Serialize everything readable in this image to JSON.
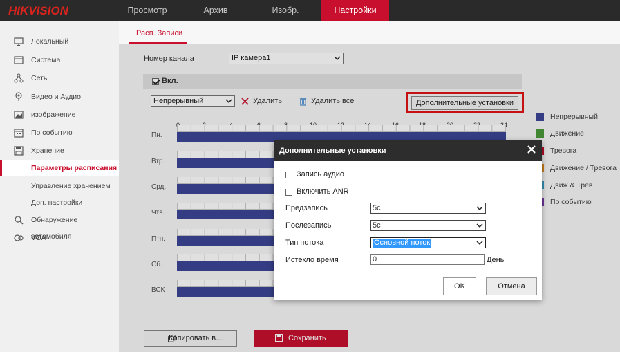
{
  "brand": {
    "logo": "HIKVISION"
  },
  "nav": {
    "tabs": [
      {
        "label": "Просмотр"
      },
      {
        "label": "Архив"
      },
      {
        "label": "Изобр."
      },
      {
        "label": "Настройки",
        "active": true
      }
    ]
  },
  "sidebar": {
    "items": [
      {
        "label": "Локальный",
        "icon": "monitor-icon"
      },
      {
        "label": "Система",
        "icon": "system-icon"
      },
      {
        "label": "Сеть",
        "icon": "network-icon"
      },
      {
        "label": "Видео и Аудио",
        "icon": "video-audio-icon"
      },
      {
        "label": "изображение",
        "icon": "image-icon"
      },
      {
        "label": "По событию",
        "icon": "calendar-icon"
      },
      {
        "label": "Хранение",
        "icon": "storage-icon"
      },
      {
        "label": "Параметры расписания",
        "active": true
      },
      {
        "label": "Управление хранением"
      },
      {
        "label": "Доп. настройки"
      },
      {
        "label": "Обнаружение автомобиля",
        "icon": "vehicle-icon"
      },
      {
        "label": "VCA",
        "icon": "vca-icon"
      }
    ]
  },
  "main": {
    "subtab": "Расп. Записи",
    "channel_label": "Номер канала",
    "channel_value": "IP камера1",
    "enable_label": "Вкл.",
    "enable_checked": true,
    "mode_value": "Непрерывный",
    "delete_label": "Удалить",
    "delete_all_label": "Удалить все",
    "advanced_button": "Дополнительные установки",
    "hours": [
      "0",
      "2",
      "4",
      "6",
      "8",
      "10",
      "12",
      "14",
      "16",
      "18",
      "20",
      "22",
      "24"
    ],
    "days": [
      "Пн.",
      "Втр.",
      "Срд.",
      "Чтв.",
      "Птн.",
      "Сб.",
      "ВСК"
    ],
    "copy_button": "Копировать в....",
    "save_button": "Сохранить"
  },
  "legend": [
    {
      "label": "Непрерывный",
      "color": "#3c4696"
    },
    {
      "label": "Движение",
      "color": "#4a9a3a"
    },
    {
      "label": "Тревога",
      "color": "#c8102e"
    },
    {
      "label": "Движение / Тревога",
      "color": "#e08a1e"
    },
    {
      "label": "Движ & Трев",
      "color": "#3aa0c8"
    },
    {
      "label": "По событию",
      "color": "#7a3aa8"
    }
  ],
  "modal": {
    "title": "Дополнительные установки",
    "audio_label": "Запись аудио",
    "anr_label": "Включить ANR",
    "prerecord_label": "Предзапись",
    "prerecord_value": "5с",
    "postrecord_label": "Послезапись",
    "postrecord_value": "5с",
    "stream_label": "Тип потока",
    "stream_value": "Основной поток",
    "expire_label": "Истекло время",
    "expire_value": "0",
    "expire_unit": "День",
    "ok_button": "OK",
    "cancel_button": "Отмена"
  }
}
